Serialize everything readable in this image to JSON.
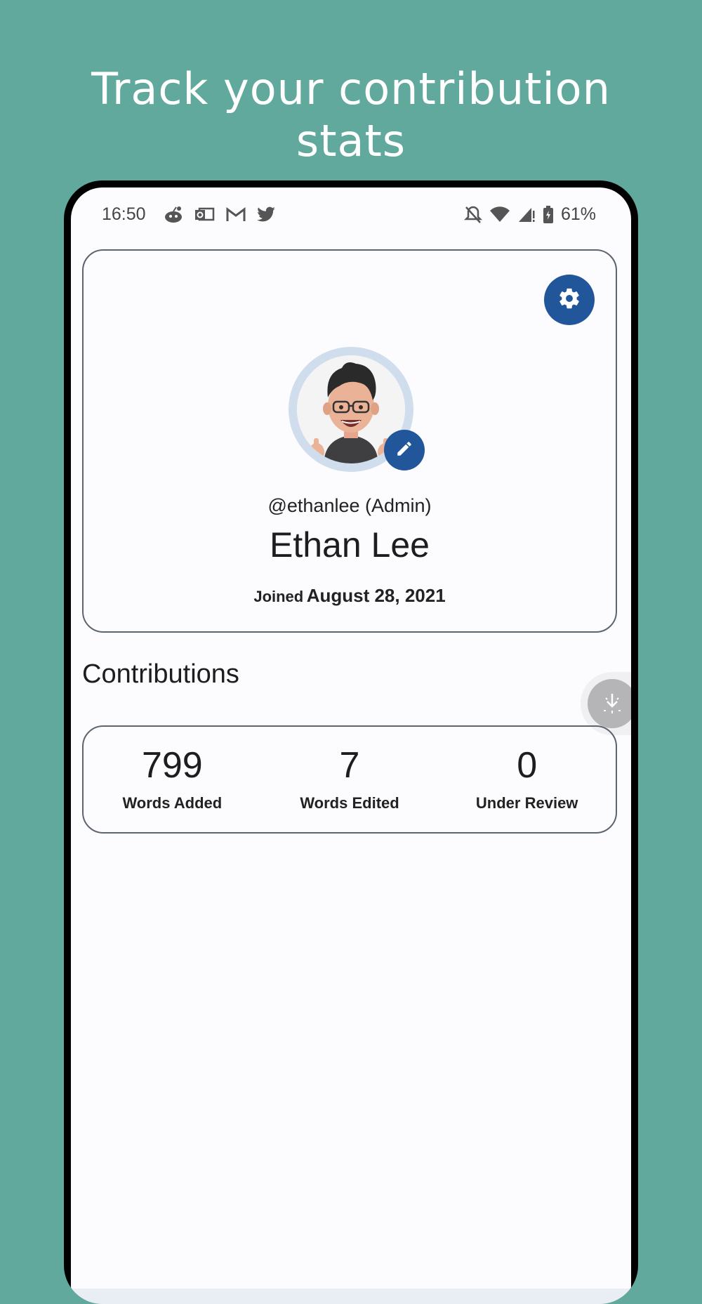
{
  "promo": {
    "headline_line1": "Track your contribution",
    "headline_line2": "stats"
  },
  "statusbar": {
    "time": "16:50",
    "battery": "61%",
    "left_icons": [
      "reddit-icon",
      "outlook-icon",
      "gmail-icon",
      "twitter-icon"
    ],
    "right_icons": [
      "bell-off-icon",
      "wifi-icon",
      "signal-icon",
      "battery-icon"
    ]
  },
  "profile": {
    "username": "@ethanlee (Admin)",
    "name": "Ethan Lee",
    "joined_label": "Joined",
    "joined_date": "August 28, 2021"
  },
  "contributions": {
    "title": "Contributions",
    "stats": [
      {
        "value": "799",
        "label": "Words Added"
      },
      {
        "value": "7",
        "label": "Words Edited"
      },
      {
        "value": "0",
        "label": "Under Review"
      }
    ]
  },
  "colors": {
    "background": "#61a99c",
    "accent": "#22569a",
    "avatar_ring": "#d0ddec"
  }
}
